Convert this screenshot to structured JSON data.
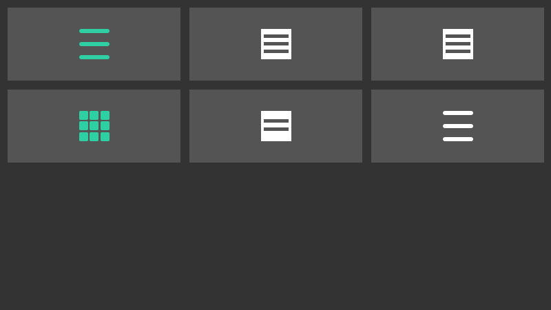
{
  "theme": {
    "background": "#333333",
    "tile": "#545454",
    "accent": "#2ecfa2",
    "white": "#ffffff"
  },
  "tiles": [
    {
      "icon": "hamburger-menu-icon",
      "color": "accent"
    },
    {
      "icon": "list-box-three-rows-icon",
      "color": "white"
    },
    {
      "icon": "list-box-three-rows-icon",
      "color": "white"
    },
    {
      "icon": "grid-apps-icon",
      "color": "accent"
    },
    {
      "icon": "list-box-two-rows-icon",
      "color": "white"
    },
    {
      "icon": "hamburger-menu-icon",
      "color": "white"
    }
  ]
}
